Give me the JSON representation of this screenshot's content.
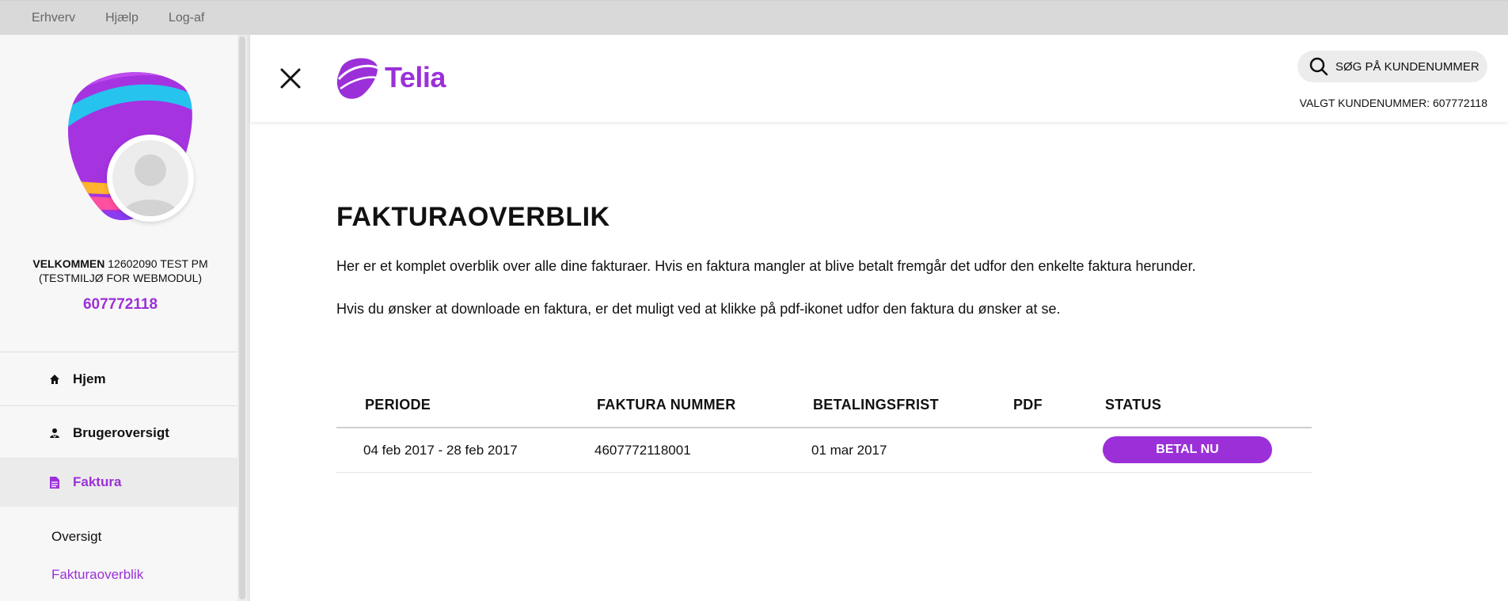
{
  "topbar": {
    "links": [
      "Erhverv",
      "Hjælp",
      "Log-af"
    ]
  },
  "sidebar": {
    "welcome_label": "VELKOMMEN",
    "welcome_rest": "12602090 TEST PM",
    "welcome_line2": "(TESTMILJØ FOR WEBMODUL)",
    "customer_number": "607772118",
    "nav": [
      {
        "label": "Hjem",
        "icon": "home-icon"
      },
      {
        "label": "Brugeroversigt",
        "icon": "users-icon"
      },
      {
        "label": "Faktura",
        "icon": "document-icon",
        "active": true
      }
    ],
    "subnav": [
      {
        "label": "Oversigt"
      },
      {
        "label": "Fakturaoverblik",
        "active": true
      }
    ]
  },
  "header": {
    "brand": "Telia",
    "search_label": "SØG PÅ KUNDENUMMER",
    "chosen_label": "VALGT KUNDENUMMER: 607772118"
  },
  "main": {
    "title": "FAKTURAOVERBLIK",
    "paragraph1": "Her er et komplet overblik over alle dine fakturaer. Hvis en faktura mangler at blive betalt fremgår det udfor den enkelte faktura herunder.",
    "paragraph2": "Hvis du ønsker at downloade en faktura, er det muligt ved at klikke på pdf-ikonet udfor den faktura du ønsker at se.",
    "table": {
      "headers": [
        "PERIODE",
        "FAKTURA NUMMER",
        "BETALINGSFRIST",
        "PDF",
        "STATUS"
      ],
      "rows": [
        {
          "period": "04 feb 2017 - 28 feb 2017",
          "invoice_number": "4607772118001",
          "due": "01 mar 2017",
          "pdf": "",
          "status_button": "BETAL NU"
        }
      ]
    }
  },
  "colors": {
    "accent": "#9b30d9",
    "topbar": "#d9d9d9",
    "sidebar": "#f7f7f7"
  }
}
